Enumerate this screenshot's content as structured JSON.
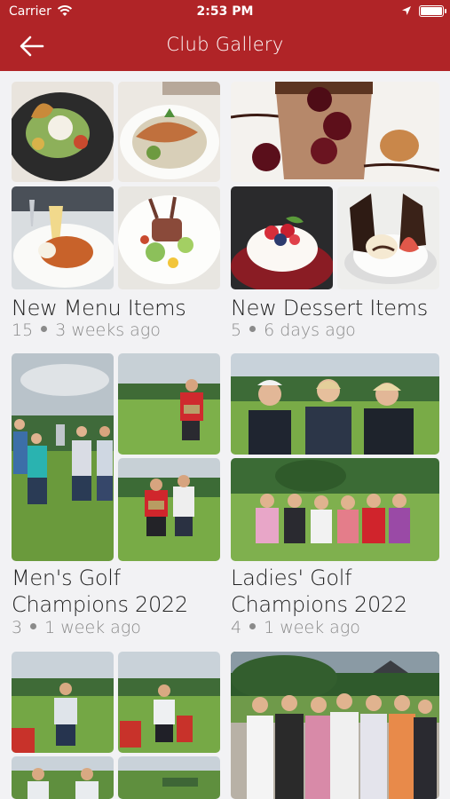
{
  "status_bar": {
    "carrier": "Carrier",
    "time": "2:53 PM"
  },
  "nav": {
    "title": "Club Gallery",
    "back_icon": "arrow-left-icon"
  },
  "colors": {
    "header": "#b02427",
    "background": "#f2f2f4",
    "meta_text": "#8a8a8a"
  },
  "albums": [
    {
      "title_line1": "New Menu Items",
      "title_line2": "",
      "count": "15",
      "age": "3 weeks ago"
    },
    {
      "title_line1": "New Dessert Items",
      "title_line2": "",
      "count": "5",
      "age": "6 days ago"
    },
    {
      "title_line1": "Men's Golf",
      "title_line2": "Champions 2022",
      "count": "3",
      "age": "1 week ago"
    },
    {
      "title_line1": "Ladies' Golf",
      "title_line2": "Champions 2022",
      "count": "4",
      "age": "1 week ago"
    }
  ]
}
